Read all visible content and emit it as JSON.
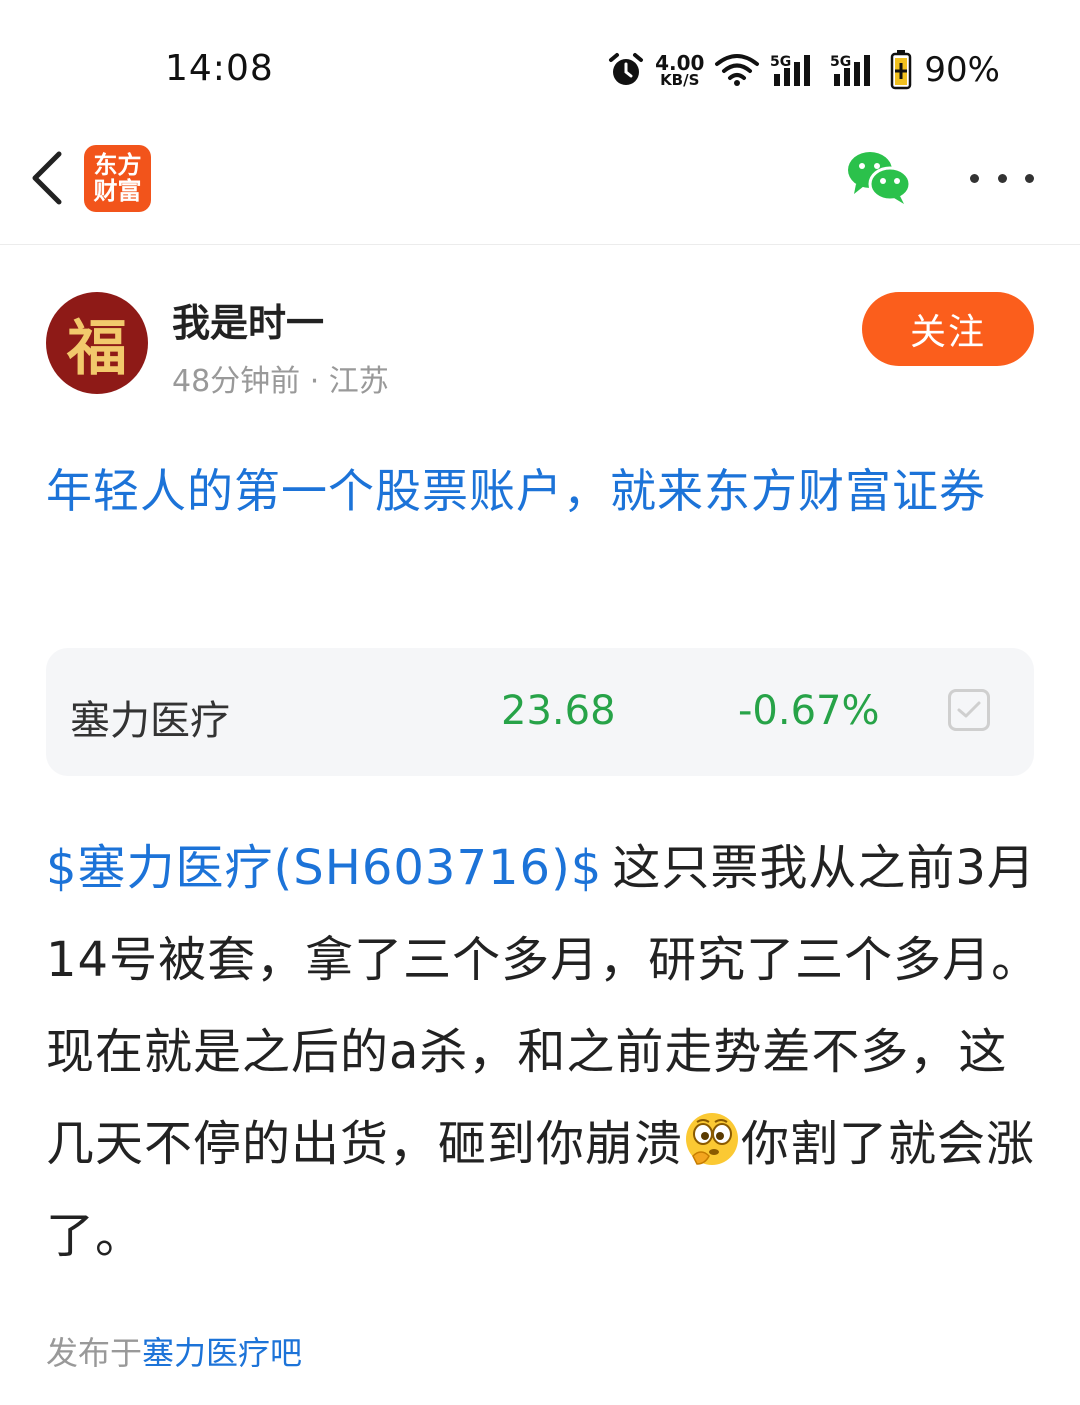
{
  "status_bar": {
    "time": "14:08",
    "net_speed_value": "4.00",
    "net_speed_unit": "KB/S",
    "signal_1": "5G",
    "signal_2": "5G",
    "battery": "90%"
  },
  "nav": {
    "logo_line1": "东方",
    "logo_line2": "财富",
    "brand_color": "#f2541b",
    "icons": [
      "chevron-left-icon",
      "wechat-icon",
      "more-icon"
    ]
  },
  "author": {
    "avatar_char": "福",
    "name": "我是时一",
    "meta": "48分钟前 · 江苏",
    "follow_label": "关注",
    "follow_color": "#fb5e1c"
  },
  "ad_title": "年轻人的第一个股票账户，就来东方财富证券",
  "stock": {
    "name": "塞力医疗",
    "price": "23.68",
    "change": "-0.67%",
    "change_color": "#27a348"
  },
  "post": {
    "stock_tag": "$塞力医疗(SH603716)$",
    "text_part1": "这只票我从之前3月14号被套，拿了三个多月，研究了三个多月。现在就是之后的a杀，和之前走势差不多，这几天不停的出货，砸到你崩溃",
    "text_part2": "你割了就会涨了。",
    "link_color": "#1c73d8"
  },
  "published": {
    "prefix": "发布于",
    "bar_name": "塞力医疗吧"
  }
}
